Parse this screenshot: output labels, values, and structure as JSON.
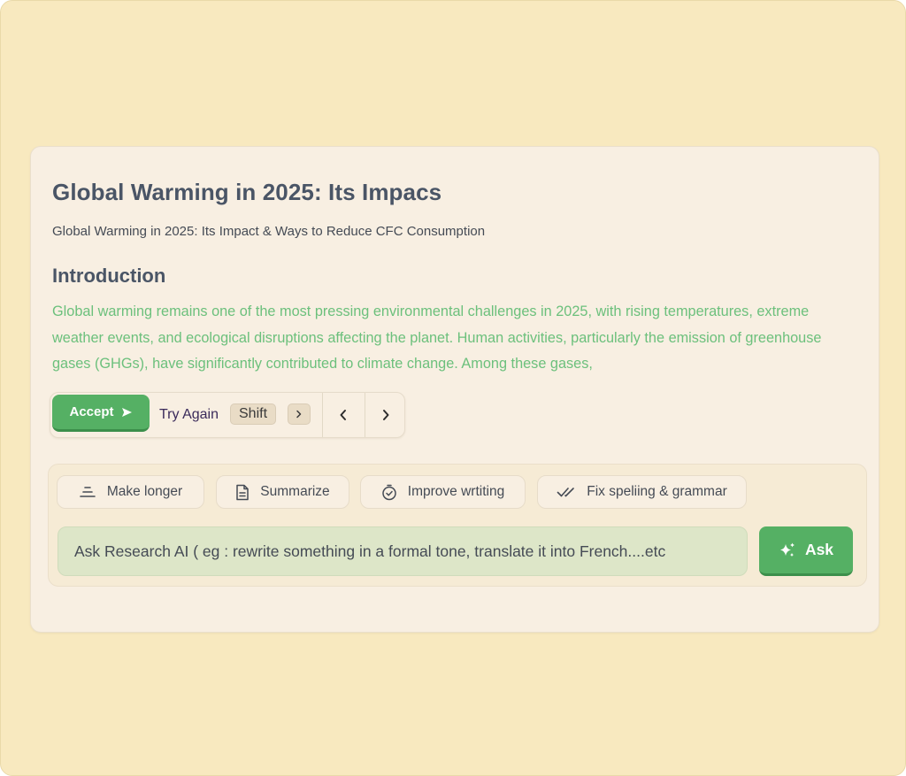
{
  "document": {
    "title": "Global Warming in 2025: Its Impacs",
    "subtitle": "Global Warming in 2025: Its Impact & Ways to Reduce CFC Consumption",
    "section_heading": "Introduction",
    "suggestion_text": "Global warming remains one of the most pressing environmental challenges in 2025, with rising temperatures, extreme weather events, and ecological disruptions affecting the planet. Human activities, particularly the emission of greenhouse gases (GHGs), have significantly contributed to climate change. Among these gases,"
  },
  "suggestion_bar": {
    "accept_label": "Accept",
    "try_again_label": "Try Again",
    "shortcut_key": "Shift",
    "icons": {
      "accept": "send-icon",
      "shortcut": "chevron-right-icon",
      "previous": "chevron-left-icon",
      "next": "chevron-right-icon"
    }
  },
  "ai_panel": {
    "actions": [
      {
        "label": "Make longer",
        "icon": "align-center-icon"
      },
      {
        "label": "Summarize",
        "icon": "document-icon"
      },
      {
        "label": "Improve wrtiting",
        "icon": "timer-check-icon"
      },
      {
        "label": "Fix speliing & grammar",
        "icon": "double-check-icon"
      }
    ],
    "input_placeholder": "Ask Research AI ( eg : rewrite something in a formal tone, translate it into French....etc",
    "ask_label": "Ask",
    "ask_icon": "sparkles-icon"
  },
  "colors": {
    "background": "#f8e9bf",
    "card": "#f8efe2",
    "accent_green": "#55b064",
    "suggestion_text": "#6cc07c",
    "heading_text": "#4a5566",
    "input_fill": "#dde6c8"
  }
}
